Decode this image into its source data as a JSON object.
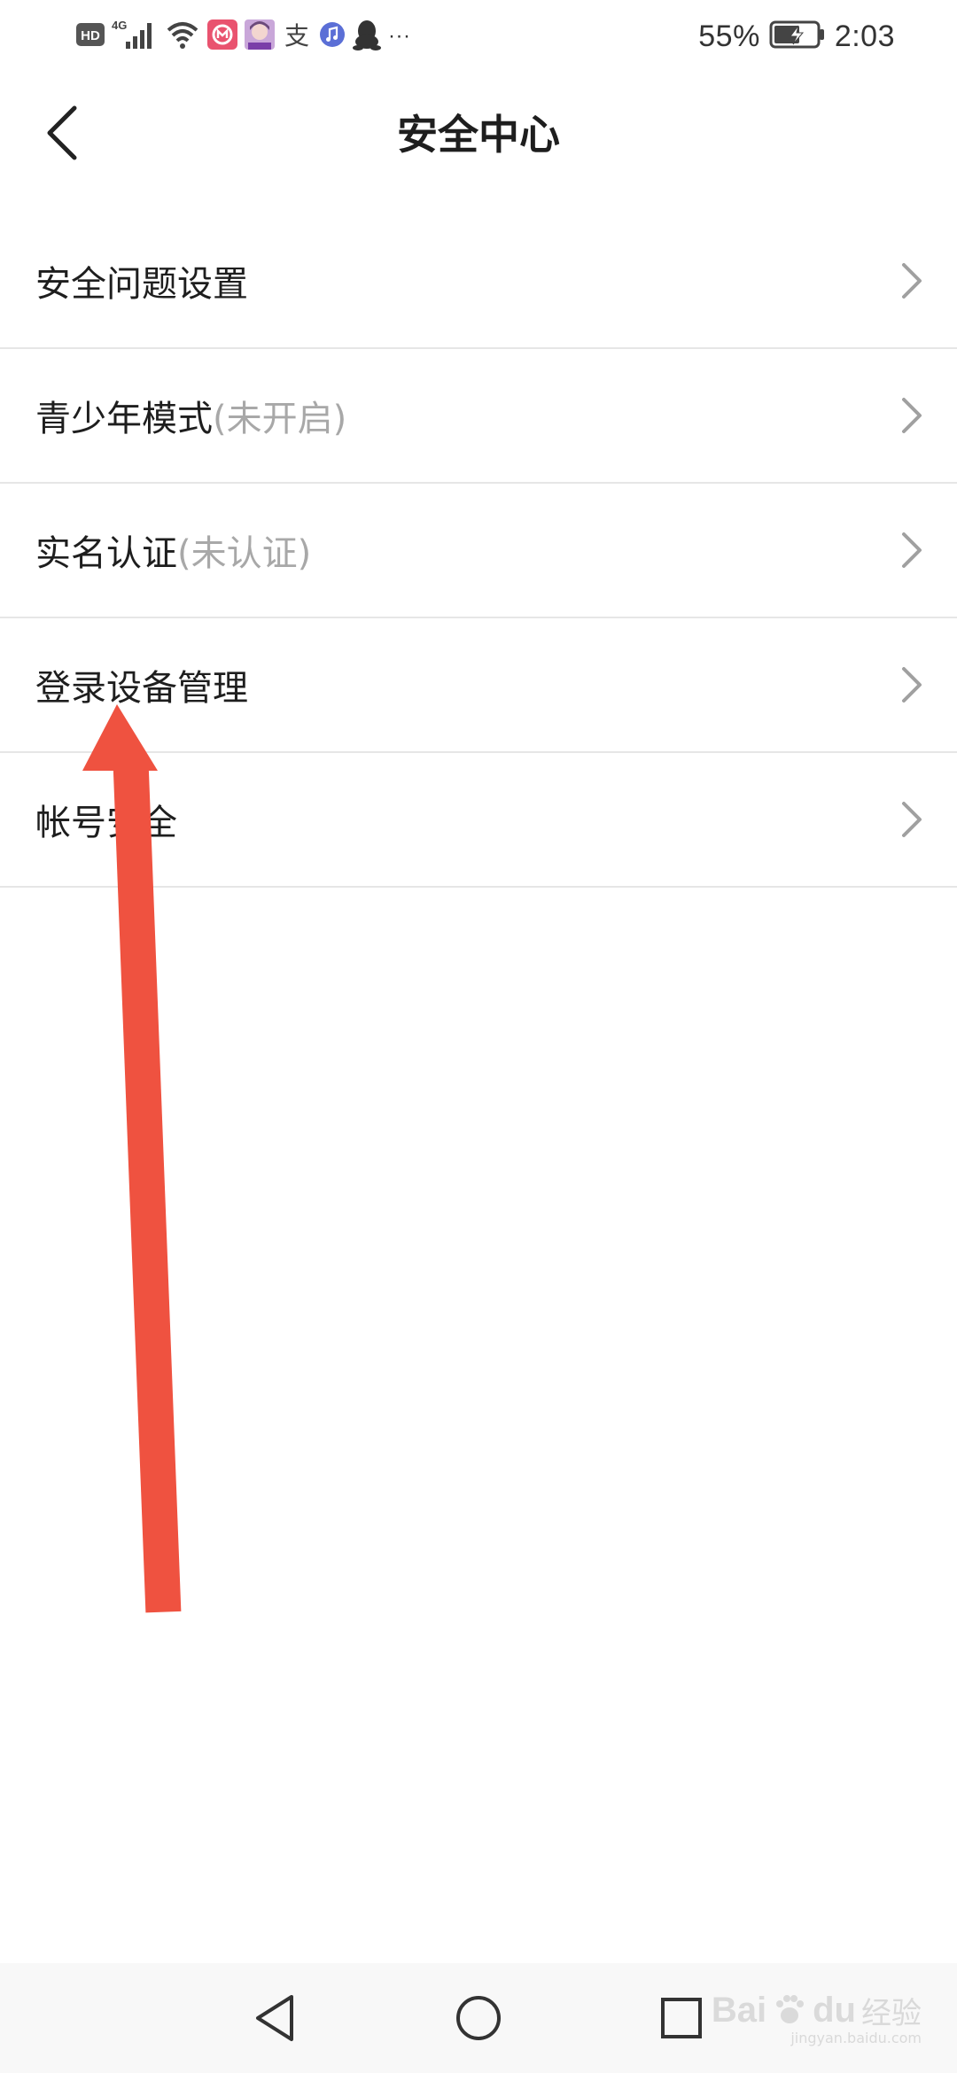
{
  "status_bar": {
    "hd_badge": "HD",
    "network": "4G",
    "alipay_char": "支",
    "more": "···",
    "battery": "55%",
    "time": "2:03"
  },
  "header": {
    "title": "安全中心",
    "back_icon": "chevron-left-icon"
  },
  "menu": {
    "items": [
      {
        "label": "安全问题设置",
        "sub": ""
      },
      {
        "label": "青少年模式",
        "sub": "(未开启)"
      },
      {
        "label": "实名认证",
        "sub": "(未认证)"
      },
      {
        "label": "登录设备管理",
        "sub": ""
      },
      {
        "label": "帐号安全",
        "sub": ""
      }
    ],
    "chevron_icon": "chevron-right-icon"
  },
  "nav_bar": {
    "back_icon": "triangle-back-icon",
    "home_icon": "circle-home-icon",
    "recent_icon": "square-recent-icon"
  },
  "watermark": {
    "brand": "Bai",
    "brand2": "du",
    "suffix": "经验",
    "url": "jingyan.baidu.com"
  },
  "colors": {
    "annotation_arrow": "#ef5240",
    "divider": "#e6e6e6",
    "sub_text": "#a8a8a8"
  }
}
